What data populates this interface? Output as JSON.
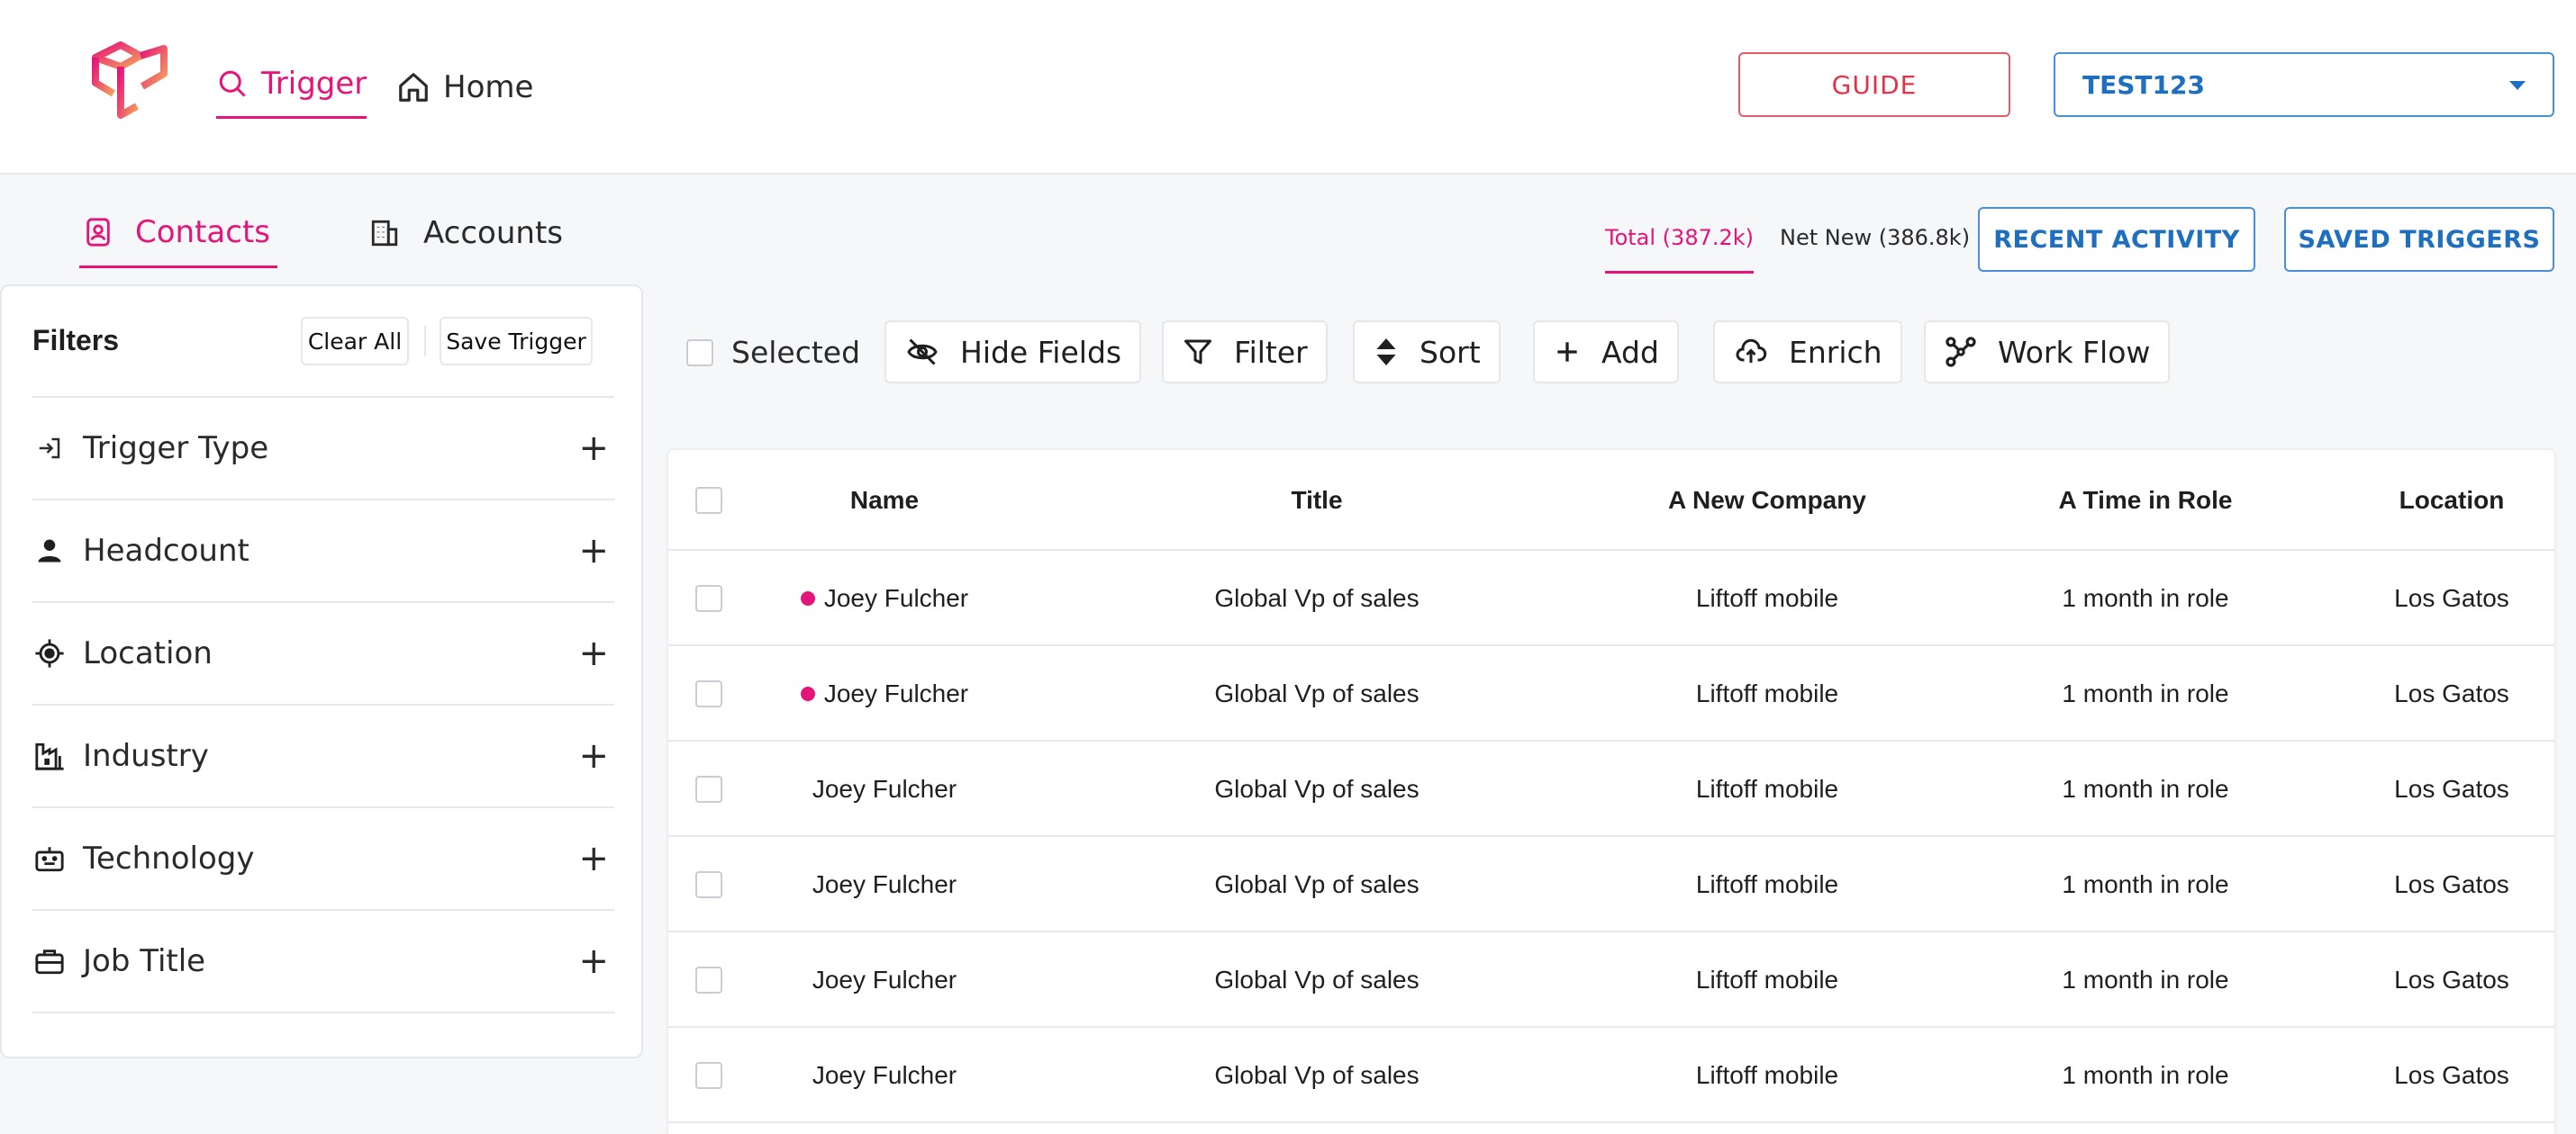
{
  "colors": {
    "accent": "#e4147a",
    "primary_blue": "#1e6fbf",
    "guide_red": "#e0344a"
  },
  "header": {
    "logo": "cube-logo",
    "nav": [
      {
        "label": "Trigger",
        "icon": "search-icon",
        "active": true
      },
      {
        "label": "Home",
        "icon": "home-icon",
        "active": false
      }
    ],
    "guide_label": "GUIDE",
    "workspace": {
      "selected": "TEST123"
    }
  },
  "subtabs": [
    {
      "label": "Contacts",
      "icon": "contact-card-icon",
      "active": true
    },
    {
      "label": "Accounts",
      "icon": "building-icon",
      "active": false
    }
  ],
  "counts": {
    "total": "Total (387.2k)",
    "net_new": "Net New (386.8k)"
  },
  "actions": {
    "recent_activity": "RECENT ACTIVITY",
    "saved_triggers": "SAVED TRIGGERS"
  },
  "filters": {
    "title": "Filters",
    "clear_all": "Clear All",
    "save_trigger": "Save Trigger",
    "items": [
      {
        "label": "Trigger Type",
        "icon": "login-icon"
      },
      {
        "label": "Headcount",
        "icon": "person-icon"
      },
      {
        "label": "Location",
        "icon": "crosshair-icon"
      },
      {
        "label": "Industry",
        "icon": "factory-icon"
      },
      {
        "label": "Technology",
        "icon": "robot-icon"
      },
      {
        "label": "Job Title",
        "icon": "briefcase-icon"
      }
    ]
  },
  "toolbar": {
    "selected_label": "Selected",
    "hide_fields": "Hide Fields",
    "filter": "Filter",
    "sort": "Sort",
    "add": "Add",
    "enrich": "Enrich",
    "work_flow": "Work Flow"
  },
  "table": {
    "columns": [
      "Name",
      "Title",
      "A New Company",
      "A Time in Role",
      "Location"
    ],
    "rows": [
      {
        "name": "Joey Fulcher",
        "title": "Global Vp of sales",
        "company": "Liftoff mobile",
        "time_in_role": "1 month in role",
        "location": "Los Gatos",
        "new": true
      },
      {
        "name": "Joey Fulcher",
        "title": "Global Vp of sales",
        "company": "Liftoff mobile",
        "time_in_role": "1 month in role",
        "location": "Los Gatos",
        "new": true
      },
      {
        "name": "Joey Fulcher",
        "title": "Global Vp of sales",
        "company": "Liftoff mobile",
        "time_in_role": "1 month in role",
        "location": "Los Gatos",
        "new": false
      },
      {
        "name": "Joey Fulcher",
        "title": "Global Vp of sales",
        "company": "Liftoff mobile",
        "time_in_role": "1 month in role",
        "location": "Los Gatos",
        "new": false
      },
      {
        "name": "Joey Fulcher",
        "title": "Global Vp of sales",
        "company": "Liftoff mobile",
        "time_in_role": "1 month in role",
        "location": "Los Gatos",
        "new": false
      },
      {
        "name": "Joey Fulcher",
        "title": "Global Vp of sales",
        "company": "Liftoff mobile",
        "time_in_role": "1 month in role",
        "location": "Los Gatos",
        "new": false
      }
    ]
  }
}
